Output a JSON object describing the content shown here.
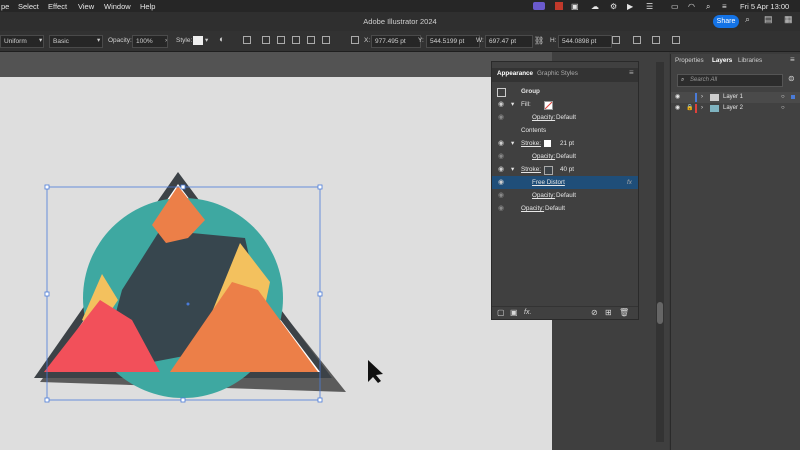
{
  "menubar": {
    "items": [
      "pe",
      "Select",
      "Effect",
      "View",
      "Window",
      "Help"
    ],
    "datetime": "Fri 5 Apr  13:00"
  },
  "window": {
    "title": "Adobe Illustrator 2024",
    "share_label": "Share"
  },
  "control_bar": {
    "stroke_profile": "Uniform",
    "brush": "Basic",
    "opacity_label": "Opacity:",
    "opacity_value": "100%",
    "style_label": "Style:",
    "x_label": "X:",
    "x_value": "977.495 pt",
    "y_label": "Y:",
    "y_value": "544.5199 pt",
    "w_label": "W:",
    "w_value": "697.47 pt",
    "h_label": "H:",
    "h_value": "544.0898 pt"
  },
  "appearance": {
    "tabs": [
      "Appearance",
      "Graphic Styles"
    ],
    "group_label": "Group",
    "fill_label": "Fill:",
    "opacity_label": "Opacity:",
    "opacity_default": "Default",
    "contents_label": "Contents",
    "stroke_label": "Stroke:",
    "stroke1_value": "21 pt",
    "stroke2_value": "40 pt",
    "effect_label": "Free Distort",
    "fx_label": "fx"
  },
  "layers_panel": {
    "tabs": [
      "Properties",
      "Layers",
      "Libraries"
    ],
    "search_placeholder": "Search All",
    "layers": [
      "Layer 1",
      "Layer 2"
    ]
  },
  "colors": {
    "teal": "#3ea8a1",
    "navy": "#37464e",
    "orange": "#ec7f48",
    "yellow": "#f3c15e",
    "red": "#f2505a",
    "selection_blue": "#4a7bd8",
    "layer1_color": "#4a7bd8",
    "layer2_color": "#e0413b"
  }
}
